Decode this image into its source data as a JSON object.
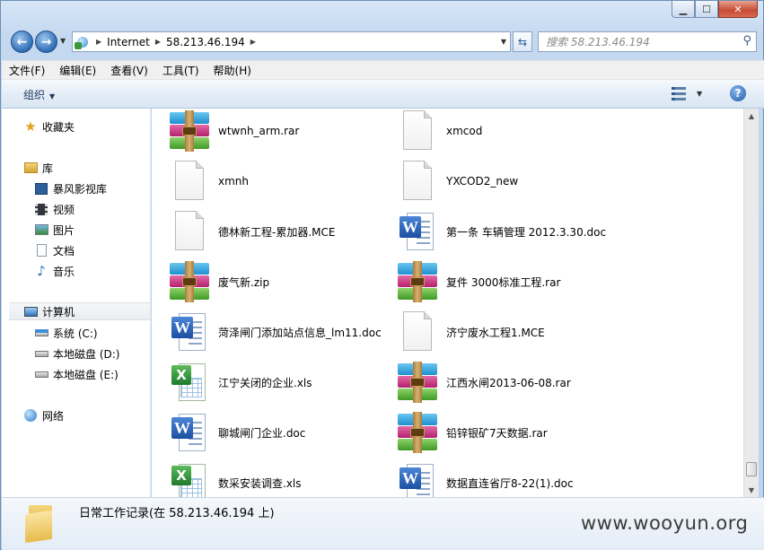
{
  "window": {
    "minimize": "▁",
    "maximize": "☐",
    "close": "✕"
  },
  "nav": {
    "back_glyph": "←",
    "forward_glyph": "→"
  },
  "address": {
    "crumbs": [
      "Internet",
      "58.213.46.194"
    ]
  },
  "search": {
    "placeholder": "搜索 58.213.46.194"
  },
  "menu": [
    "文件(F)",
    "编辑(E)",
    "查看(V)",
    "工具(T)",
    "帮助(H)"
  ],
  "command_bar": {
    "organize": "组织"
  },
  "nav_pane": {
    "favorites": "收藏夹",
    "libraries": "库",
    "library_items": [
      "暴风影视库",
      "视频",
      "图片",
      "文档",
      "音乐"
    ],
    "computer": "计算机",
    "drives": [
      "系统 (C:)",
      "本地磁盘 (D:)",
      "本地磁盘 (E:)"
    ],
    "network": "网络"
  },
  "files": [
    {
      "name": "wtwnh_arm.rar",
      "type": "rar"
    },
    {
      "name": "xmcod",
      "type": "blank"
    },
    {
      "name": "xmnh",
      "type": "blank"
    },
    {
      "name": "YXCOD2_new",
      "type": "blank"
    },
    {
      "name": "德林新工程-累加器.MCE",
      "type": "blank"
    },
    {
      "name": "第一条  车辆管理    2012.3.30.doc",
      "type": "doc"
    },
    {
      "name": "废气新.zip",
      "type": "rar"
    },
    {
      "name": "复件 3000标准工程.rar",
      "type": "rar"
    },
    {
      "name": "菏泽闸门添加站点信息_lm11.doc",
      "type": "doc"
    },
    {
      "name": "济宁废水工程1.MCE",
      "type": "blank"
    },
    {
      "name": "江宁关闭的企业.xls",
      "type": "xls"
    },
    {
      "name": "江西水闸2013-06-08.rar",
      "type": "rar"
    },
    {
      "name": "聊城闸门企业.doc",
      "type": "doc"
    },
    {
      "name": "铅锌银矿7天数据.rar",
      "type": "rar"
    },
    {
      "name": "数采安装调查.xls",
      "type": "xls"
    },
    {
      "name": "数据直连省厅8-22(1).doc",
      "type": "doc"
    }
  ],
  "details": {
    "title": "日常工作记录(在 58.213.46.194 上)"
  },
  "watermark": "www.wooyun.org"
}
